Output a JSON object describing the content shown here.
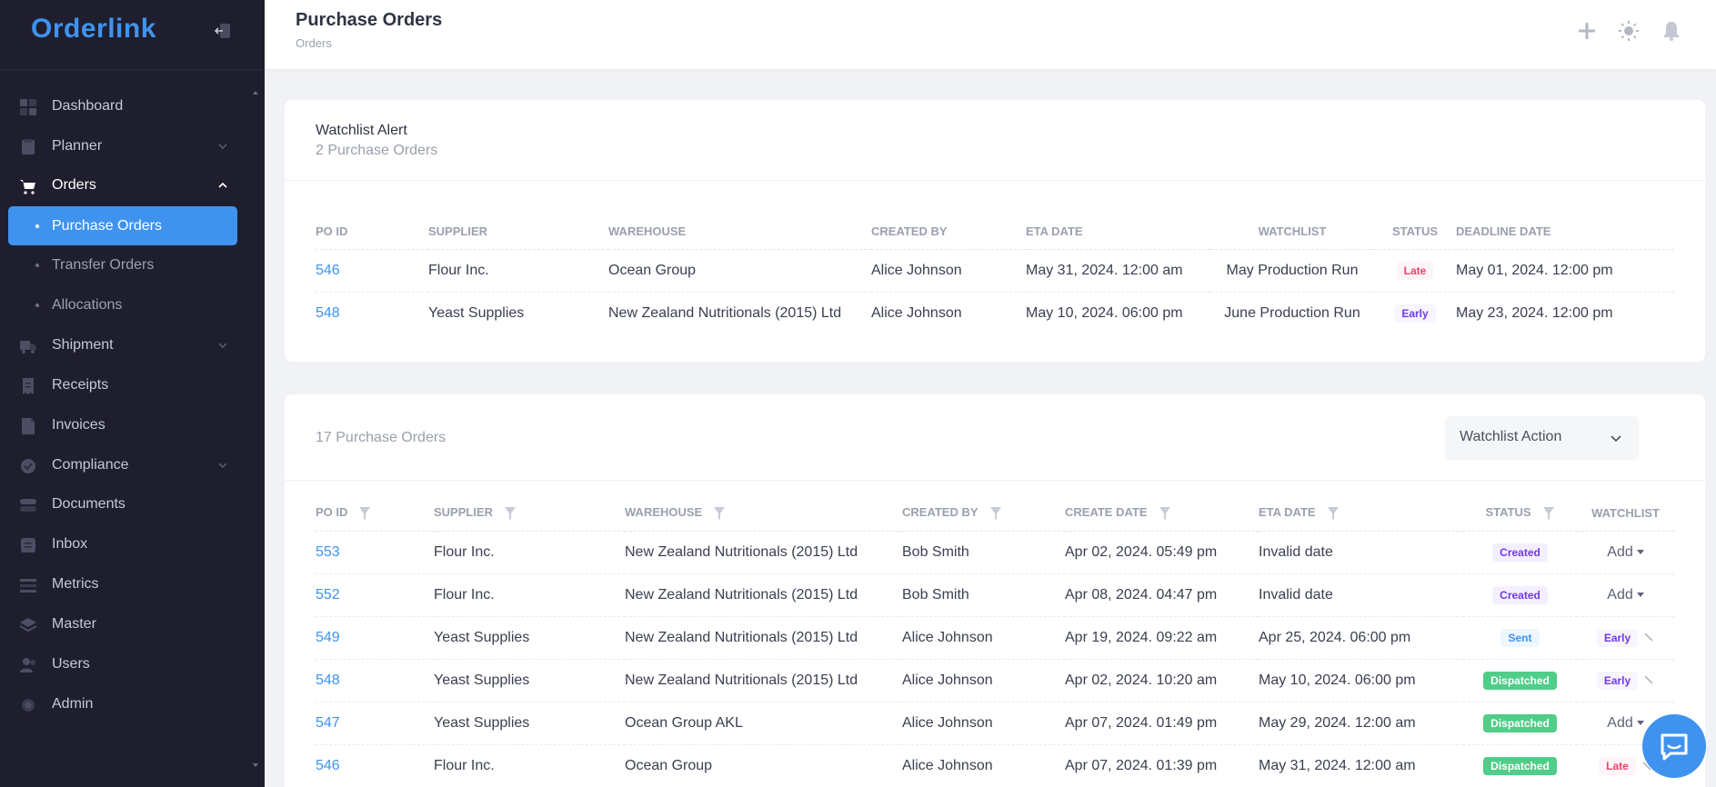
{
  "app": {
    "brand": "Orderlink",
    "accent_color": "#3f93ef"
  },
  "sidebar": {
    "items": [
      {
        "label": "Dashboard",
        "icon": "dashboard-icon"
      },
      {
        "label": "Planner",
        "icon": "planner-icon"
      },
      {
        "label": "Orders",
        "icon": "cart-icon"
      },
      {
        "label": "Shipment",
        "icon": "truck-icon"
      },
      {
        "label": "Receipts",
        "icon": "receipt-icon"
      },
      {
        "label": "Invoices",
        "icon": "invoice-icon"
      },
      {
        "label": "Compliance",
        "icon": "check-badge-icon"
      },
      {
        "label": "Documents",
        "icon": "documents-icon"
      },
      {
        "label": "Inbox",
        "icon": "inbox-icon"
      },
      {
        "label": "Metrics",
        "icon": "metrics-icon"
      },
      {
        "label": "Master",
        "icon": "layers-icon"
      },
      {
        "label": "Users",
        "icon": "users-icon"
      },
      {
        "label": "Admin",
        "icon": "admin-gear-icon"
      }
    ],
    "orders_sub": [
      {
        "label": "Purchase Orders",
        "active": true
      },
      {
        "label": "Transfer Orders",
        "active": false
      },
      {
        "label": "Allocations",
        "active": false
      }
    ]
  },
  "header": {
    "title": "Purchase Orders",
    "breadcrumb": "Orders"
  },
  "watchlist_card": {
    "title": "Watchlist Alert",
    "subtitle": "2 Purchase Orders",
    "columns": [
      "PO ID",
      "SUPPLIER",
      "WAREHOUSE",
      "CREATED BY",
      "ETA DATE",
      "WATCHLIST",
      "STATUS",
      "DEADLINE DATE"
    ],
    "rows": [
      {
        "po_id": "546",
        "supplier": "Flour Inc.",
        "warehouse": "Ocean Group",
        "created_by": "Alice Johnson",
        "eta_date": "May 31, 2024. 12:00 am",
        "watchlist": "May Production Run",
        "status": "Late",
        "deadline": "May 01, 2024. 12:00 pm"
      },
      {
        "po_id": "548",
        "supplier": "Yeast Supplies",
        "warehouse": "New Zealand Nutritionals (2015) Ltd",
        "created_by": "Alice Johnson",
        "eta_date": "May 10, 2024. 06:00 pm",
        "watchlist": "June Production Run",
        "status": "Early",
        "deadline": "May 23, 2024. 12:00 pm"
      }
    ]
  },
  "orders_card": {
    "count_label": "17 Purchase Orders",
    "action_select": "Watchlist Action",
    "columns": [
      "PO ID",
      "SUPPLIER",
      "WAREHOUSE",
      "CREATED BY",
      "CREATE DATE",
      "ETA DATE",
      "STATUS",
      "WATCHLIST"
    ],
    "rows": [
      {
        "po_id": "553",
        "supplier": "Flour Inc.",
        "warehouse": "New Zealand Nutritionals (2015) Ltd",
        "created_by": "Bob Smith",
        "create_date": "Apr 02, 2024. 05:49 pm",
        "eta_date": "Invalid date",
        "status": "Created",
        "watchlist": "Add"
      },
      {
        "po_id": "552",
        "supplier": "Flour Inc.",
        "warehouse": "New Zealand Nutritionals (2015) Ltd",
        "created_by": "Bob Smith",
        "create_date": "Apr 08, 2024. 04:47 pm",
        "eta_date": "Invalid date",
        "status": "Created",
        "watchlist": "Add"
      },
      {
        "po_id": "549",
        "supplier": "Yeast Supplies",
        "warehouse": "New Zealand Nutritionals (2015) Ltd",
        "created_by": "Alice Johnson",
        "create_date": "Apr 19, 2024. 09:22 am",
        "eta_date": "Apr 25, 2024. 06:00 pm",
        "status": "Sent",
        "watchlist": "Early"
      },
      {
        "po_id": "548",
        "supplier": "Yeast Supplies",
        "warehouse": "New Zealand Nutritionals (2015) Ltd",
        "created_by": "Alice Johnson",
        "create_date": "Apr 02, 2024. 10:20 am",
        "eta_date": "May 10, 2024. 06:00 pm",
        "status": "Dispatched",
        "watchlist": "Early"
      },
      {
        "po_id": "547",
        "supplier": "Yeast Supplies",
        "warehouse": "Ocean Group AKL",
        "created_by": "Alice Johnson",
        "create_date": "Apr 07, 2024. 01:49 pm",
        "eta_date": "May 29, 2024. 12:00 am",
        "status": "Dispatched",
        "watchlist": "Add"
      },
      {
        "po_id": "546",
        "supplier": "Flour Inc.",
        "warehouse": "Ocean Group",
        "created_by": "Alice Johnson",
        "create_date": "Apr 07, 2024. 01:39 pm",
        "eta_date": "May 31, 2024. 12:00 am",
        "status": "Dispatched",
        "watchlist": "Late"
      }
    ]
  }
}
